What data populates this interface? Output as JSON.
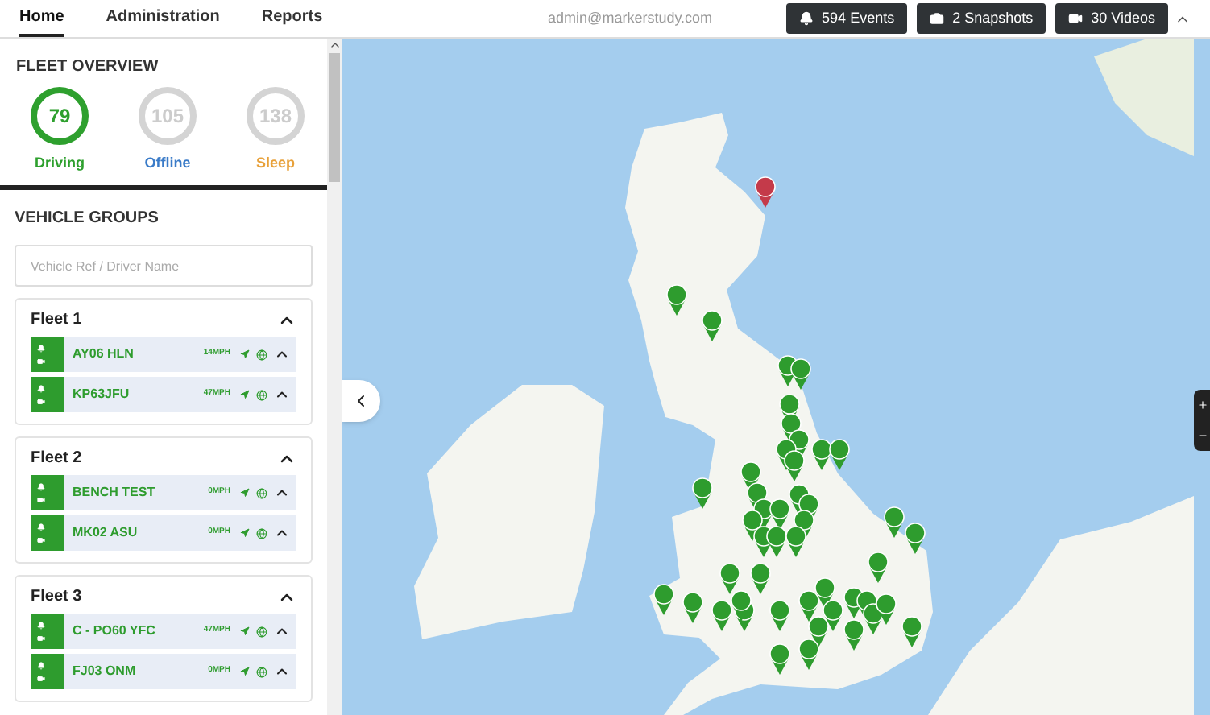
{
  "nav": {
    "tabs": [
      {
        "label": "Home",
        "selected": true
      },
      {
        "label": "Administration",
        "selected": false
      },
      {
        "label": "Reports",
        "selected": false
      }
    ],
    "user": "admin@markerstudy.com",
    "buttons": [
      {
        "kind": "events",
        "label": "594 Events"
      },
      {
        "kind": "snapshots",
        "label": "2 Snapshots"
      },
      {
        "kind": "videos",
        "label": "30 Videos"
      }
    ]
  },
  "fleet_overview": {
    "title": "FLEET OVERVIEW",
    "stats": [
      {
        "value": "79",
        "label": "Driving",
        "color": "#2ea02e"
      },
      {
        "value": "105",
        "label": "Offline",
        "color": "#3a7bc8"
      },
      {
        "value": "138",
        "label": "Sleep",
        "color": "#e8a13a"
      }
    ]
  },
  "vehicle_groups": {
    "title": "VEHICLE GROUPS",
    "search": {
      "placeholder": "Vehicle Ref / Driver Name"
    },
    "groups": [
      {
        "name": "Fleet 1",
        "vehicles": [
          {
            "ref": "AY06 HLN",
            "speed": "14MPH"
          },
          {
            "ref": "KP63JFU",
            "speed": "47MPH"
          }
        ]
      },
      {
        "name": "Fleet 2",
        "vehicles": [
          {
            "ref": "BENCH TEST",
            "speed": "0MPH"
          },
          {
            "ref": "MK02 ASU",
            "speed": "0MPH"
          }
        ]
      },
      {
        "name": "Fleet 3",
        "vehicles": [
          {
            "ref": "C - PO60 YFC",
            "speed": "47MPH"
          },
          {
            "ref": "FJ03 ONM",
            "speed": "0MPH"
          }
        ]
      }
    ]
  }
}
